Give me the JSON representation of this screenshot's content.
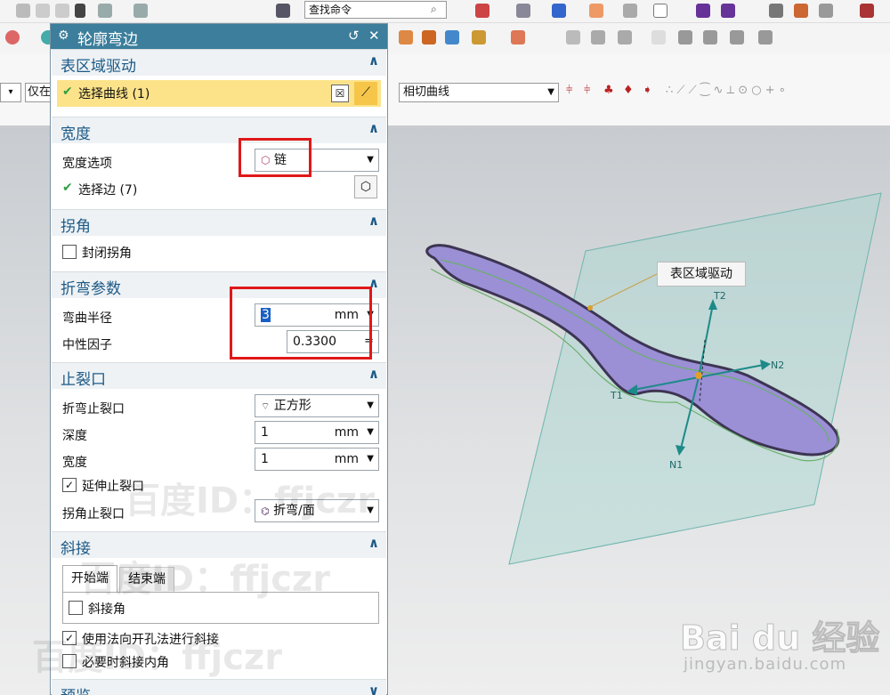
{
  "toolbar": {
    "find_command": "查找命令",
    "combo_left": "▾",
    "renzai": "仅在",
    "tangent_curves": "相切曲线"
  },
  "dialog": {
    "title": "轮廓弯边",
    "reset_icon": "↺",
    "close_icon": "✕",
    "sections": {
      "surface_drive": {
        "title": "表区域驱动",
        "select_curve": "选择曲线 (1)"
      },
      "width": {
        "title": "宽度",
        "width_option_label": "宽度选项",
        "width_option_value": "链",
        "select_edge": "选择边 (7)"
      },
      "corner": {
        "title": "拐角",
        "close_corner": "封闭拐角"
      },
      "bend_params": {
        "title": "折弯参数",
        "bend_radius_label": "弯曲半径",
        "bend_radius_value": "3",
        "bend_radius_unit": "mm",
        "neutral_factor_label": "中性因子",
        "neutral_factor_value": "0.3300",
        "neutral_factor_eq": "="
      },
      "relief": {
        "title": "止裂口",
        "bend_relief_label": "折弯止裂口",
        "bend_relief_value": "正方形",
        "depth_label": "深度",
        "depth_value": "1",
        "depth_unit": "mm",
        "width_label": "宽度",
        "width_value": "1",
        "width_unit": "mm",
        "extend_relief": "延伸止裂口",
        "corner_relief_label": "拐角止裂口",
        "corner_relief_value": "折弯/面"
      },
      "miter": {
        "title": "斜接",
        "tab_start": "开始端",
        "tab_end": "结束端",
        "miter_angle": "斜接角",
        "use_normal_hole": "使用法向开孔法进行斜接",
        "miter_inner_if_needed": "必要时斜接内角"
      },
      "preview": {
        "title": "预览"
      }
    }
  },
  "viewport": {
    "annotation_label": "表区域驱动",
    "axes": {
      "t2": "T2",
      "n2": "N2",
      "t1": "T1",
      "n1": "N1"
    }
  },
  "watermarks": {
    "baidu_id_1": "百度ID：ffjczr",
    "baidu_id_2": "百度ID：ffjczr",
    "baidu_id_3": "百度ID：ffjczr",
    "baidu_logo": "Bai du 经验",
    "baidu_url": "jingyan.baidu.com"
  },
  "colors": {
    "title_bar": "#3c7e9b",
    "section_title": "#1d5a86",
    "selected_row": "#fce38a",
    "highlight_box": "#e01818",
    "part_fill": "#9b8fd6",
    "plane_fill": "#a6d8d0"
  }
}
